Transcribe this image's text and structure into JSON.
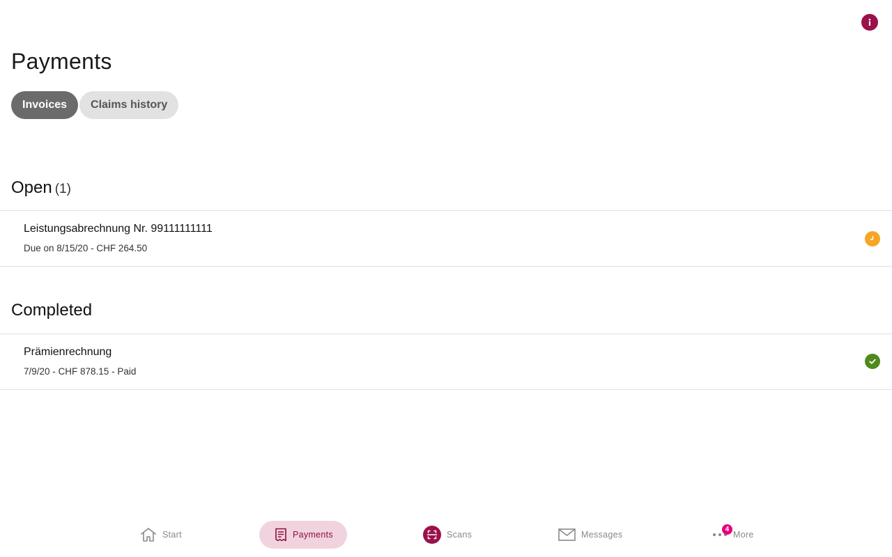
{
  "header": {
    "title": "Payments",
    "info_icon": "info-icon"
  },
  "tabs": [
    {
      "label": "Invoices",
      "active": true
    },
    {
      "label": "Claims history",
      "active": false
    }
  ],
  "sections": {
    "open": {
      "title": "Open",
      "count": "(1)",
      "items": [
        {
          "title": "Leistungsabrechnung Nr. 99111111111",
          "subtitle": "Due on 8/15/20 - CHF 264.50",
          "status": "pending",
          "status_icon": "clock-icon",
          "status_color": "#f5a623"
        }
      ]
    },
    "completed": {
      "title": "Completed",
      "items": [
        {
          "title": "Prämienrechnung",
          "subtitle": "7/9/20 - CHF 878.15 - Paid",
          "status": "paid",
          "status_icon": "check-icon",
          "status_color": "#4e8a1c"
        }
      ]
    }
  },
  "bottom_nav": {
    "items": [
      {
        "label": "Start",
        "icon": "home-icon",
        "active": false
      },
      {
        "label": "Payments",
        "icon": "receipt-icon",
        "active": true
      },
      {
        "label": "Scans",
        "icon": "scan-icon",
        "active": false
      },
      {
        "label": "Messages",
        "icon": "envelope-icon",
        "active": false
      },
      {
        "label": "More",
        "icon": "more-dots-icon",
        "active": false,
        "badge": "4"
      }
    ]
  },
  "colors": {
    "brand": "#9b1149",
    "active_tab": "#6b6b6b",
    "inactive_tab": "#e2e2e2",
    "nav_active_bg": "#f1d3df",
    "badge": "#e6007e"
  }
}
